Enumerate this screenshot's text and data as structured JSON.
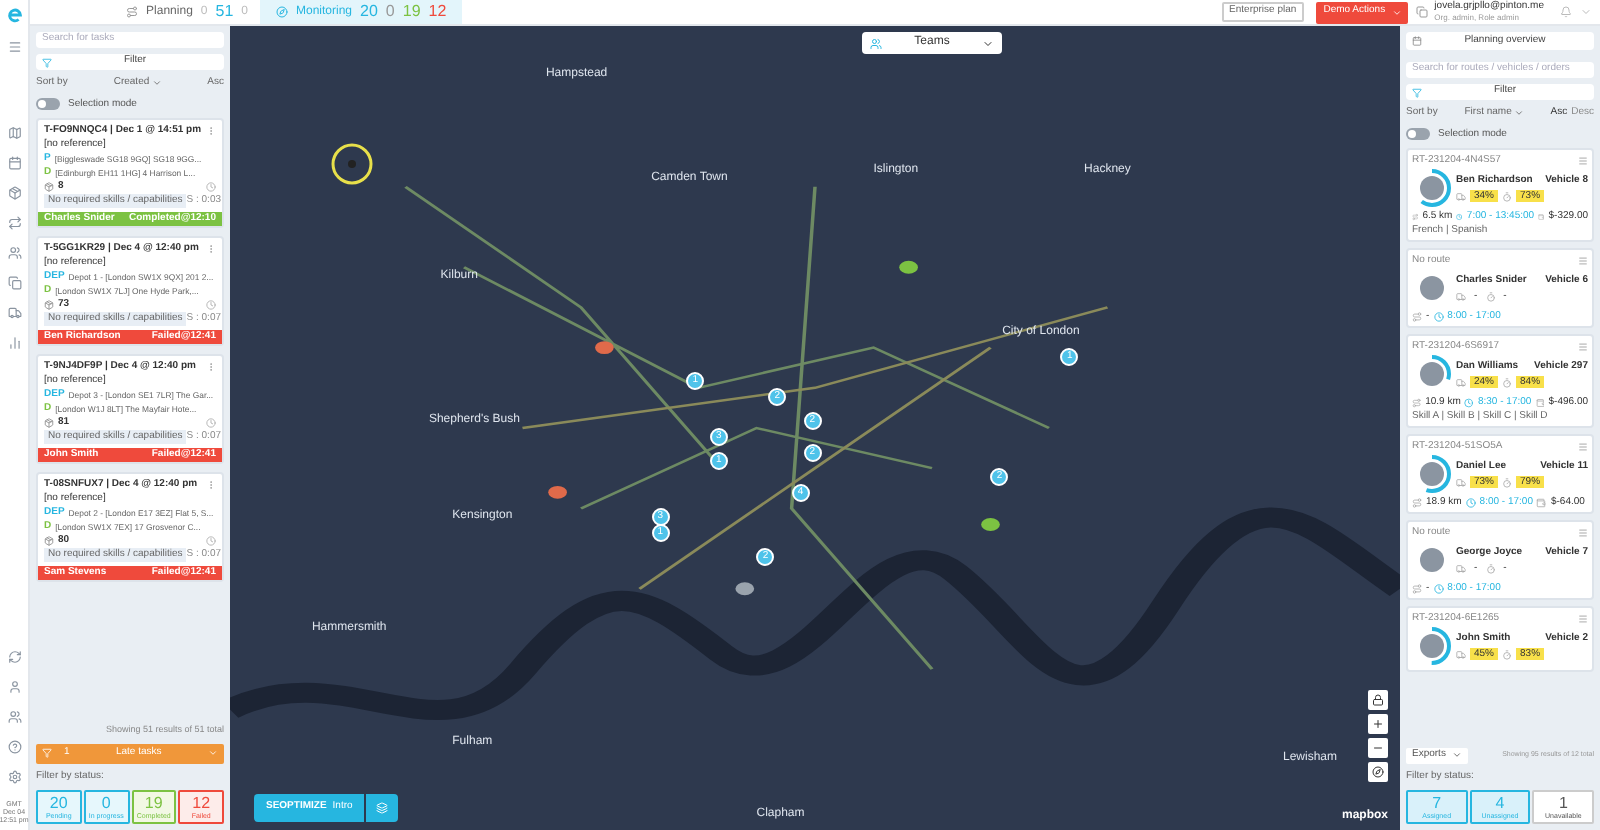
{
  "rail": {
    "time": [
      "GMT",
      "Dec 04",
      "12:51 pm"
    ]
  },
  "top_bar": {
    "planning": {
      "label": "Planning",
      "counts": [
        "0",
        "51",
        "0"
      ]
    },
    "monitoring": {
      "label": "Monitoring",
      "selected": true,
      "counts": [
        "20",
        "0",
        "19",
        "12"
      ]
    },
    "plan": "Enterprise plan",
    "action": "Demo Actions",
    "user": {
      "email": "jovela.grjpllo@pinton.me",
      "role": "Org. admin, Role admin"
    }
  },
  "tasks_panel": {
    "search": {
      "placeholder": "Search for tasks"
    },
    "filter": "Filter",
    "sort_label": "Sort by",
    "sort_value": "Created",
    "order": "Asc",
    "selection": {
      "label": "Selection mode",
      "on": false
    },
    "tasks": [
      {
        "title": "T-FO9NNQC4 | Dec 1 @ 14:51 pm",
        "reference": "[no reference]",
        "from_tag": "P",
        "from": "[Biggleswade SG18 9GQ] SG18 9GG...",
        "to_tag": "D",
        "to": "[Edinburgh EH11 1HG] 4 Harrison L...",
        "count": "8",
        "skills": "No required skills / capabilities",
        "duration": "S : 0:03",
        "driver": "Charles Snider",
        "status": "Completed@12:10",
        "color": "#7cc242"
      },
      {
        "title": "T-5GG1KR29 | Dec 4 @ 12:40 pm",
        "reference": "[no reference]",
        "from_tag": "DEP",
        "from": "Depot 1 - [London SW1X 9QX] 201 2...",
        "to_tag": "D",
        "to": "[London SW1X 7LJ] One Hyde Park,...",
        "count": "73",
        "skills": "No required skills / capabilities",
        "duration": "S : 0:07",
        "driver": "Ben Richardson",
        "status": "Failed@12:41",
        "color": "#ef4a3c"
      },
      {
        "title": "T-9NJ4DF9P | Dec 4 @ 12:40 pm",
        "reference": "[no reference]",
        "from_tag": "DEP",
        "from": "Depot 3 - [London SE1 7LR] The Gar...",
        "to_tag": "D",
        "to": "[London W1J 8LT] The Mayfair Hote...",
        "count": "81",
        "skills": "No required skills / capabilities",
        "duration": "S : 0:07",
        "driver": "John Smith",
        "status": "Failed@12:41",
        "color": "#ef4a3c"
      },
      {
        "title": "T-08SNFUX7 | Dec 4 @ 12:40 pm",
        "reference": "[no reference]",
        "from_tag": "DEP",
        "from": "Depot 2 - [London E17 3EZ] Flat 5, S...",
        "to_tag": "D",
        "to": "[London SW1X 7EX] 17 Grosvenor C...",
        "count": "80",
        "skills": "No required skills / capabilities",
        "duration": "S : 0:07",
        "driver": "Sam Stevens",
        "status": "Failed@12:41",
        "color": "#ef4a3c"
      }
    ],
    "showing": "Showing 51 results of 51 total",
    "late": {
      "count": "1",
      "label": "Late tasks"
    },
    "filter_label": "Filter by status:",
    "statuses": [
      {
        "value": "20",
        "label": "Pending",
        "kind": "pending"
      },
      {
        "value": "0",
        "label": "In progress",
        "kind": "progress"
      },
      {
        "value": "19",
        "label": "Completed",
        "kind": "completed"
      },
      {
        "value": "12",
        "label": "Failed",
        "kind": "failed"
      }
    ]
  },
  "map": {
    "teams": "Teams",
    "labels": [
      "Hampstead",
      "Kilburn",
      "Camden Town",
      "Islington",
      "Hackney",
      "City of London",
      "Shepherd's Bush",
      "Kensington",
      "Hammersmith",
      "Fulham",
      "Clapham",
      "Lewisham"
    ],
    "pins": [
      "1",
      "2",
      "3",
      "2",
      "1",
      "2",
      "4",
      "3",
      "1",
      "2",
      "2",
      "1"
    ],
    "optimize": "SEOPTIMIZE",
    "optimize_sub": "Intro",
    "brand": "mapbox"
  },
  "routes_panel": {
    "overview": "Planning overview",
    "search": {
      "placeholder": "Search for routes / vehicles / orders"
    },
    "filter": "Filter",
    "sort_label": "Sort by",
    "sort_value": "First name",
    "orders": [
      {
        "label": "Asc",
        "selected": true
      },
      {
        "label": "Desc",
        "selected": false
      }
    ],
    "selection": {
      "label": "Selection mode",
      "on": false
    },
    "routes": [
      {
        "id": "RT-231204-4N4S57",
        "driver": "Ben Richardson",
        "vehicle": "Vehicle 8",
        "load": "34%",
        "time": "73%",
        "distance": "6.5 km",
        "window": "7:00 - 13:45:00",
        "cost": "$-329.00",
        "tags": "French | Spanish",
        "level": 0.6
      },
      {
        "id": "No route",
        "driver": "Charles Snider",
        "vehicle": "Vehicle 6",
        "load": "-",
        "time": "-",
        "distance": "-",
        "window": "8:00 - 17:00",
        "level": 0
      },
      {
        "id": "RT-231204-6S6917",
        "driver": "Dan Williams",
        "vehicle": "Vehicle 297",
        "load": "24%",
        "time": "84%",
        "distance": "10.9 km",
        "window": "8:30 - 17:00",
        "cost": "$-496.00",
        "tags": "Skill A | Skill B | Skill C | Skill D",
        "level": 0.3
      },
      {
        "id": "RT-231204-51SO5A",
        "driver": "Daniel Lee",
        "vehicle": "Vehicle 11",
        "load": "73%",
        "time": "79%",
        "distance": "18.9 km",
        "window": "8:00 - 17:00",
        "cost": "$-64.00",
        "level": 0.55
      },
      {
        "id": "No route",
        "driver": "George Joyce",
        "vehicle": "Vehicle 7",
        "load": "-",
        "time": "-",
        "distance": "-",
        "window": "8:00 - 17:00",
        "level": 0
      },
      {
        "id": "RT-231204-6E1265",
        "driver": "John Smith",
        "vehicle": "Vehicle 2",
        "load": "45%",
        "time": "83%",
        "level": 0.5
      }
    ],
    "exports": "Exports",
    "showing": "Showing 95 results of 12 total",
    "filter_label": "Filter by status:",
    "statuses": [
      {
        "value": "7",
        "label": "Assigned",
        "selected": true
      },
      {
        "value": "4",
        "label": "Unassigned",
        "selected": true
      },
      {
        "value": "1",
        "label": "Unavailable",
        "selected": false
      }
    ]
  }
}
